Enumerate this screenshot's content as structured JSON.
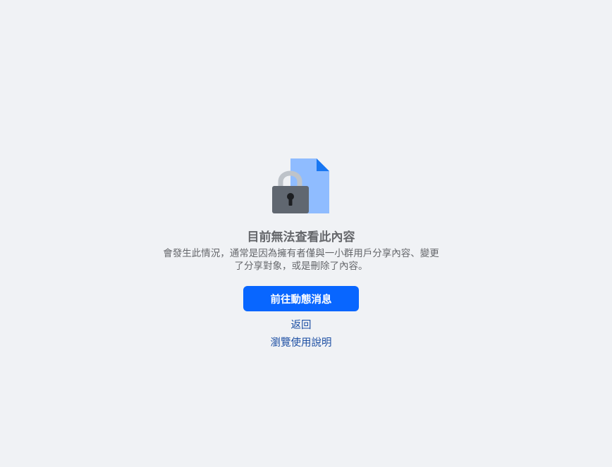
{
  "content": {
    "title": "目前無法查看此內容",
    "description": "會發生此情況，通常是因為擁有者僅與一小群用戶分享內容、變更了分享對象，或是刪除了內容。"
  },
  "actions": {
    "primary_label": "前往動態消息",
    "back_label": "返回",
    "help_label": "瀏覽使用說明"
  },
  "icons": {
    "illustration": "locked-document-icon"
  },
  "colors": {
    "background": "#f0f2f5",
    "primary_button": "#0866ff",
    "link": "#1d4fa3",
    "text": "#65676b",
    "document": "#8fbcff",
    "document_fold": "#1877f2",
    "lock_body": "#606770",
    "lock_shackle": "#bec3c9"
  }
}
